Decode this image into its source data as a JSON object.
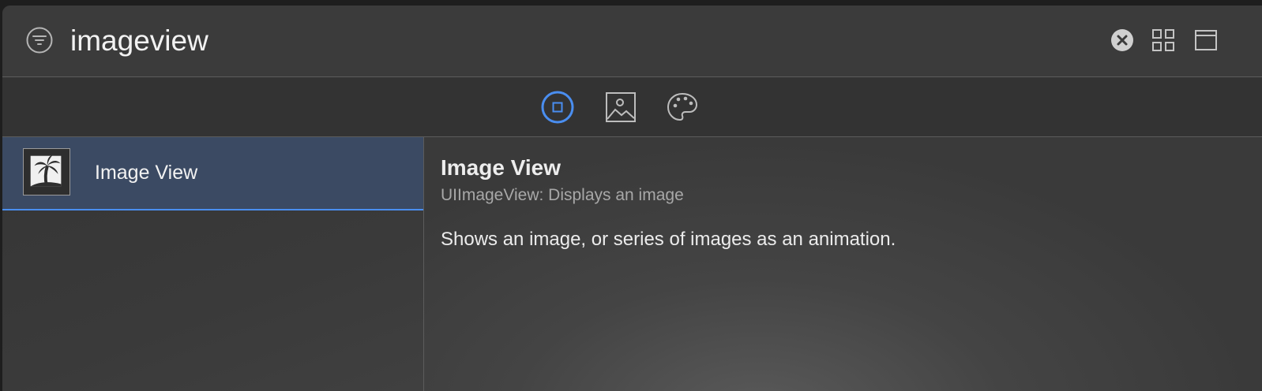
{
  "search": {
    "value": "imageview",
    "placeholder": "Filter"
  },
  "toolbar": {
    "icons": [
      "filter-icon",
      "clear-icon",
      "grid-view-icon",
      "window-icon"
    ]
  },
  "tabs": [
    {
      "name": "objects",
      "icon": "square-circle-icon",
      "selected": true
    },
    {
      "name": "media",
      "icon": "image-icon",
      "selected": false
    },
    {
      "name": "colors",
      "icon": "palette-icon",
      "selected": false
    }
  ],
  "results": [
    {
      "label": "Image View",
      "icon": "palm-tree-image-icon",
      "selected": true
    }
  ],
  "detail": {
    "title": "Image View",
    "subtitle": "UIImageView: Displays an image",
    "description": "Shows an image, or series of images as an animation."
  },
  "colors": {
    "accent": "#4a8ef0",
    "selection": "#3b4a63",
    "panel": "#3a3a3a"
  }
}
